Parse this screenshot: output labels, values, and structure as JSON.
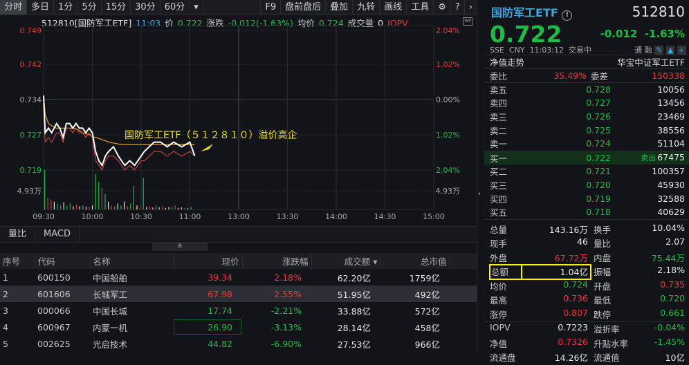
{
  "toolbar": {
    "periods": [
      "分时",
      "多日",
      "1分",
      "5分",
      "15分",
      "30分",
      "60分"
    ],
    "more": "▾",
    "tools": [
      "F9",
      "盘前盘后",
      "叠加",
      "九转",
      "画线",
      "工具"
    ],
    "gear": "⚙",
    "help": "?",
    "next": "›"
  },
  "header": {
    "code_name": "512810[国防军工ETF]",
    "time": "11:03",
    "price_label": "价",
    "price": "0.722",
    "change_label": "涨跌",
    "change": "-0.012(-1.63%)",
    "avg_label": "均价",
    "avg": "0.724",
    "vol_label": "成交量",
    "vol": "0",
    "iopv": "IOPV",
    "wp": "WP"
  },
  "chart_data": {
    "type": "line",
    "title": "512810 国防军工ETF 分时",
    "annotation": "国防军工ETF（５１２８１０）溢价高企",
    "y_left_ticks": [
      "0.749",
      "0.742",
      "0.734",
      "0.727",
      "0.719"
    ],
    "y_right_ticks": [
      "2.04%",
      "1.02%",
      "0.00%",
      "1.02%",
      "2.04%"
    ],
    "ylim": [
      0.719,
      0.749
    ],
    "prev_close": 0.734,
    "x_ticks": [
      "09:30",
      "10:00",
      "10:30",
      "11:00",
      "13:00",
      "13:30",
      "14:00",
      "14:30",
      "15:00"
    ],
    "volume_tick": "4.93万",
    "volume_max": 10,
    "minutes": [
      0,
      1,
      3,
      5,
      8,
      10,
      12,
      14,
      16,
      18,
      20,
      22,
      24,
      26,
      28,
      30,
      32,
      34,
      36,
      38,
      40,
      43,
      46,
      50,
      53,
      56,
      58,
      60,
      62,
      65,
      68,
      72,
      76,
      80,
      85,
      90,
      93
    ],
    "price": [
      0.735,
      0.727,
      0.728,
      0.727,
      0.729,
      0.728,
      0.726,
      0.729,
      0.729,
      0.728,
      0.729,
      0.728,
      0.728,
      0.727,
      0.728,
      0.727,
      0.723,
      0.721,
      0.72,
      0.722,
      0.723,
      0.724,
      0.722,
      0.72,
      0.721,
      0.72,
      0.721,
      0.722,
      0.723,
      0.724,
      0.725,
      0.725,
      0.724,
      0.725,
      0.724,
      0.725,
      0.722
    ],
    "iopv": [
      0.734,
      0.725,
      0.726,
      0.725,
      0.727,
      0.727,
      0.725,
      0.728,
      0.728,
      0.727,
      0.728,
      0.727,
      0.727,
      0.726,
      0.727,
      0.726,
      0.721,
      0.72,
      0.719,
      0.721,
      0.722,
      0.722,
      0.721,
      0.719,
      0.72,
      0.719,
      0.72,
      0.721,
      0.721,
      0.722,
      0.723,
      0.723,
      0.722,
      0.723,
      0.722,
      0.723,
      0.722
    ],
    "avg": [
      0.735,
      0.731,
      0.729,
      0.7285,
      0.728,
      0.728,
      0.728,
      0.728,
      0.728,
      0.728,
      0.7278,
      0.7275,
      0.727,
      0.7268,
      0.7266,
      0.7262,
      0.726,
      0.7258,
      0.7255,
      0.7253,
      0.725,
      0.7248,
      0.7246,
      0.7245,
      0.7245,
      0.7245,
      0.7245,
      0.7245,
      0.7245,
      0.7245,
      0.7245,
      0.7245,
      0.7245,
      0.7245,
      0.7245,
      0.7245,
      0.7245
    ],
    "volume": [
      10,
      3,
      2.5,
      2,
      1.5,
      1.2,
      1.8,
      1,
      1.5,
      0.8,
      1.2,
      0.8,
      1,
      0.7,
      0.6,
      1,
      9,
      7,
      5.5,
      4,
      2,
      1,
      0.8,
      1.5,
      1,
      2,
      0.8,
      1.5,
      6,
      1,
      0.5,
      8,
      0.6,
      0.8,
      0.5,
      1,
      0.5,
      0.8,
      0.4,
      0.6,
      0.5,
      1,
      0.4,
      0.5,
      0.4,
      0.3,
      0.6
    ],
    "volume_colors": [
      "g",
      "r",
      "r",
      "w",
      "g",
      "r",
      "w",
      "g",
      "g",
      "w",
      "r",
      "w",
      "g",
      "w",
      "r",
      "w",
      "g",
      "g",
      "r",
      "g",
      "w",
      "r",
      "g",
      "w",
      "g",
      "w",
      "r",
      "g",
      "g",
      "w",
      "r",
      "g",
      "w",
      "r",
      "w",
      "g",
      "w",
      "r",
      "w",
      "w",
      "g",
      "r",
      "w",
      "w",
      "r",
      "w",
      "g"
    ]
  },
  "indicator_tabs": [
    "量比",
    "MACD"
  ],
  "collapse": "≚",
  "table": {
    "headers": [
      "序号",
      "代码",
      "名称",
      "现价",
      "涨跌幅",
      "成交额 ▾",
      "总市值"
    ],
    "rows": [
      [
        "1",
        "600150",
        "中国船舶",
        "39.34",
        "2.18%",
        "62.20亿",
        "1759亿",
        "r"
      ],
      [
        "2",
        "601606",
        "长城军工",
        "67.98",
        "2.55%",
        "51.95亿",
        "492亿",
        "r"
      ],
      [
        "3",
        "000066",
        "中国长城",
        "17.74",
        "-2.21%",
        "33.88亿",
        "572亿",
        "g"
      ],
      [
        "4",
        "600967",
        "内蒙一机",
        "26.90",
        "-3.13%",
        "28.14亿",
        "458亿",
        "g"
      ],
      [
        "5",
        "002625",
        "光启技术",
        "44.82",
        "-6.90%",
        "27.53亿",
        "966亿",
        "g"
      ]
    ]
  },
  "quote": {
    "name": "国防军工ETF",
    "info": "!",
    "code": "512810",
    "price": "0.722",
    "change": "-0.012",
    "pct": "-1.63%",
    "exchange": "SSE",
    "currency": "CNY",
    "time": "11:03:12",
    "status": "交易中",
    "tong": "通",
    "rong": "融",
    "nav_trend": "净值走势",
    "fund_name": "华宝中证军工ETF",
    "wb_label": "委比",
    "wb": "35.49%",
    "wc_label": "委差",
    "wc": "150338",
    "sells": [
      [
        "卖五",
        "0.728",
        "10056"
      ],
      [
        "卖四",
        "0.727",
        "13456"
      ],
      [
        "卖三",
        "0.726",
        "23469"
      ],
      [
        "卖二",
        "0.725",
        "38556"
      ],
      [
        "卖一",
        "0.724",
        "51104"
      ]
    ],
    "buys": [
      [
        "买一",
        "0.722",
        "67475"
      ],
      [
        "买二",
        "0.721",
        "100357"
      ],
      [
        "买三",
        "0.720",
        "45930"
      ],
      [
        "买四",
        "0.719",
        "32588"
      ],
      [
        "买五",
        "0.718",
        "40629"
      ]
    ],
    "sell_out": "卖出",
    "stats": [
      [
        "总量",
        "143.16万",
        "w",
        "换手",
        "10.04%",
        "w"
      ],
      [
        "现手",
        "46",
        "w",
        "量比",
        "2.07",
        "w"
      ],
      [
        "外盘",
        "67.72万",
        "r",
        "内盘",
        "75.44万",
        "g"
      ],
      [
        "总额",
        "1.04亿",
        "w",
        "振幅",
        "2.18%",
        "w"
      ],
      [
        "均价",
        "0.724",
        "g",
        "开盘",
        "0.735",
        "r"
      ],
      [
        "最高",
        "0.736",
        "r",
        "最低",
        "0.720",
        "g"
      ],
      [
        "涨停",
        "0.807",
        "r",
        "跌停",
        "0.661",
        "g"
      ]
    ],
    "stats2": [
      [
        "IOPV",
        "0.7223",
        "w",
        "溢折率",
        "-0.04%",
        "g"
      ],
      [
        "净值",
        "0.7326",
        "r",
        "升贴水率",
        "-1.45%",
        "g"
      ],
      [
        "流通盘",
        "14.26亿",
        "w",
        "流通值",
        "10亿",
        "w"
      ]
    ]
  }
}
